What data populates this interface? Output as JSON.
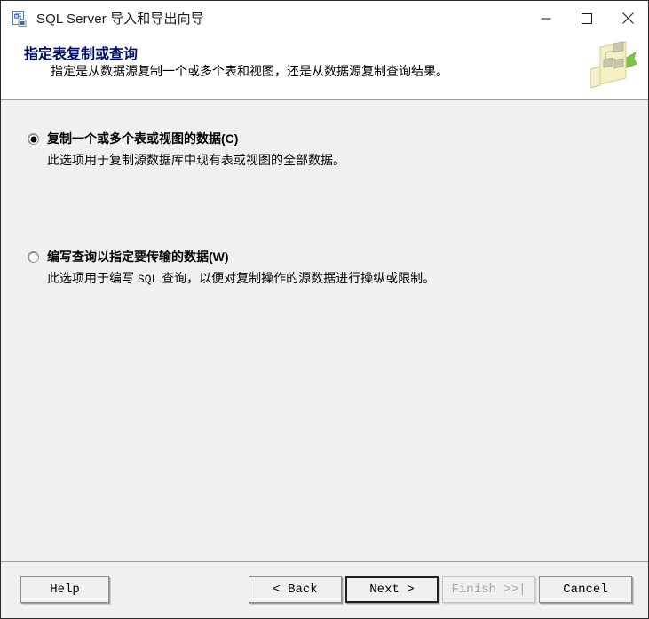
{
  "window": {
    "title": "SQL Server 导入和导出向导",
    "icon": "wizard-document-icon",
    "controls": {
      "minimize": "minimize-icon",
      "maximize": "maximize-icon",
      "close": "close-icon"
    }
  },
  "header": {
    "title": "指定表复制或查询",
    "subtitle": "指定是从数据源复制一个或多个表和视图，还是从数据源复制查询结果。",
    "icon": "table-copy-wizard-icon",
    "title_color": "#000f66"
  },
  "options": [
    {
      "id": "copy-tables",
      "label": "复制一个或多个表或视图的数据(C)",
      "description": "此选项用于复制源数据库中现有表或视图的全部数据。",
      "selected": true
    },
    {
      "id": "write-query",
      "label": "编写查询以指定要传输的数据(W)",
      "description_pre": "此选项用于编写 ",
      "description_mono": "SQL",
      "description_post": " 查询，以便对复制操作的源数据进行操纵或限制。",
      "selected": false
    }
  ],
  "footer": {
    "help": "Help",
    "back": "< Back",
    "next": "Next >",
    "finish": "Finish >>|",
    "cancel": "Cancel",
    "finish_disabled": true,
    "next_is_default": true
  },
  "colors": {
    "window_background": "#f0f0f0",
    "header_background": "#ffffff",
    "border": "#2b2b2b",
    "separator": "#a0a0a0"
  }
}
